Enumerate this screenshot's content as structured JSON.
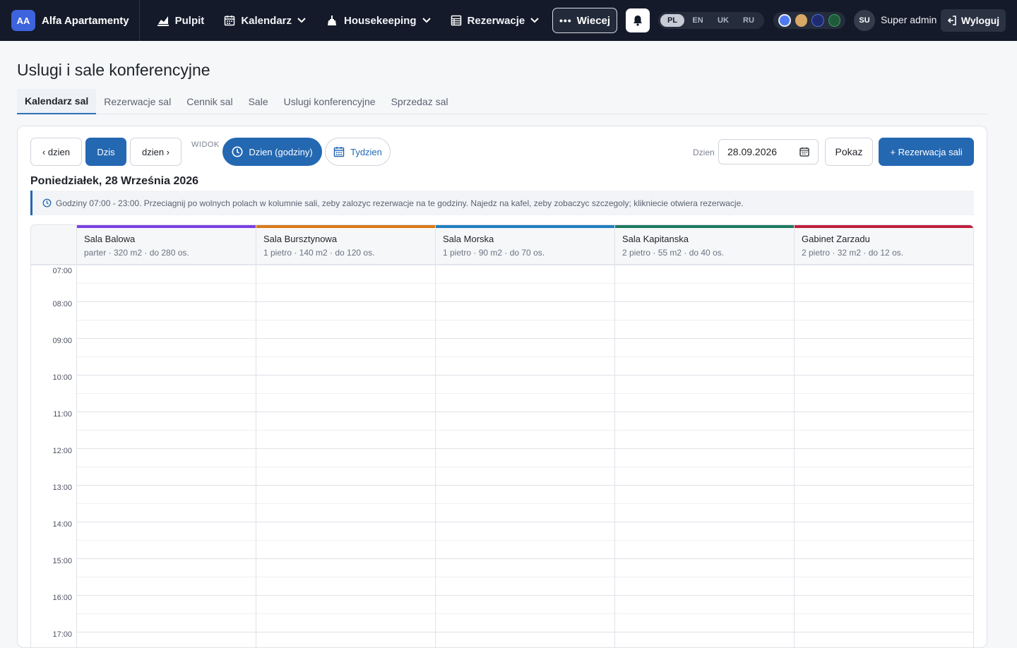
{
  "navbar": {
    "brand_badge": "AA",
    "brand_name": "Alfa Apartamenty",
    "items": [
      {
        "label": "Pulpit",
        "icon": "chart-icon",
        "dropdown": false
      },
      {
        "label": "Kalendarz",
        "icon": "calendar-icon",
        "dropdown": true
      },
      {
        "label": "Housekeeping",
        "icon": "cleaning-icon",
        "dropdown": true
      },
      {
        "label": "Rezerwacje",
        "icon": "list-icon",
        "dropdown": true
      }
    ],
    "more_label": "Wiecej",
    "languages": [
      "PL",
      "EN",
      "UK",
      "RU"
    ],
    "active_language": "PL",
    "theme_colors": [
      "#4f7bf0",
      "#d9a867",
      "#1e2b6e",
      "#1e5b3a"
    ],
    "user_initials": "SU",
    "user_name": "Super admin",
    "logout_label": "Wyloguj"
  },
  "page": {
    "title": "Uslugi i sale konferencyjne",
    "tabs": [
      "Kalendarz sal",
      "Rezerwacje sal",
      "Cennik sal",
      "Sale",
      "Uslugi konferencyjne",
      "Sprzedaz sal"
    ],
    "active_tab": "Kalendarz sal"
  },
  "toolbar": {
    "prev_day": "‹ dzien",
    "today": "Dzis",
    "next_day": "dzien ›",
    "view_label": "WIDOK",
    "view_day": "Dzien (godziny)",
    "view_week": "Tydzien",
    "day_label": "Dzien",
    "date_value": "28.09.2026",
    "show_button": "Pokaz",
    "new_reservation": "+ Rezerwacja sali"
  },
  "calendar": {
    "date_heading": "Poniedziałek, 28 Września 2026",
    "info": "Godziny 07:00 - 23:00. Przeciagnij po wolnych polach w kolumnie sali, zeby zalozyc rezerwacje na te godziny. Najedz na kafel, zeby zobaczyc szczegoly; klikniecie otwiera rezerwacje.",
    "rooms": [
      {
        "name": "Sala Balowa",
        "meta": "parter · 320 m2 · do 280 os.",
        "color": "#7b3fe4"
      },
      {
        "name": "Sala Bursztynowa",
        "meta": "1 pietro · 140 m2 · do 120 os.",
        "color": "#d97917"
      },
      {
        "name": "Sala Morska",
        "meta": "1 pietro · 90 m2 · do 70 os.",
        "color": "#1f7fc0"
      },
      {
        "name": "Sala Kapitanska",
        "meta": "2 pietro · 55 m2 · do 40 os.",
        "color": "#1d7a5f"
      },
      {
        "name": "Gabinet Zarzadu",
        "meta": "2 pietro · 32 m2 · do 12 os.",
        "color": "#c0203f"
      }
    ],
    "hours": [
      "07:00",
      "08:00",
      "09:00",
      "10:00",
      "11:00",
      "12:00",
      "13:00",
      "14:00",
      "15:00",
      "16:00",
      "17:00"
    ]
  }
}
